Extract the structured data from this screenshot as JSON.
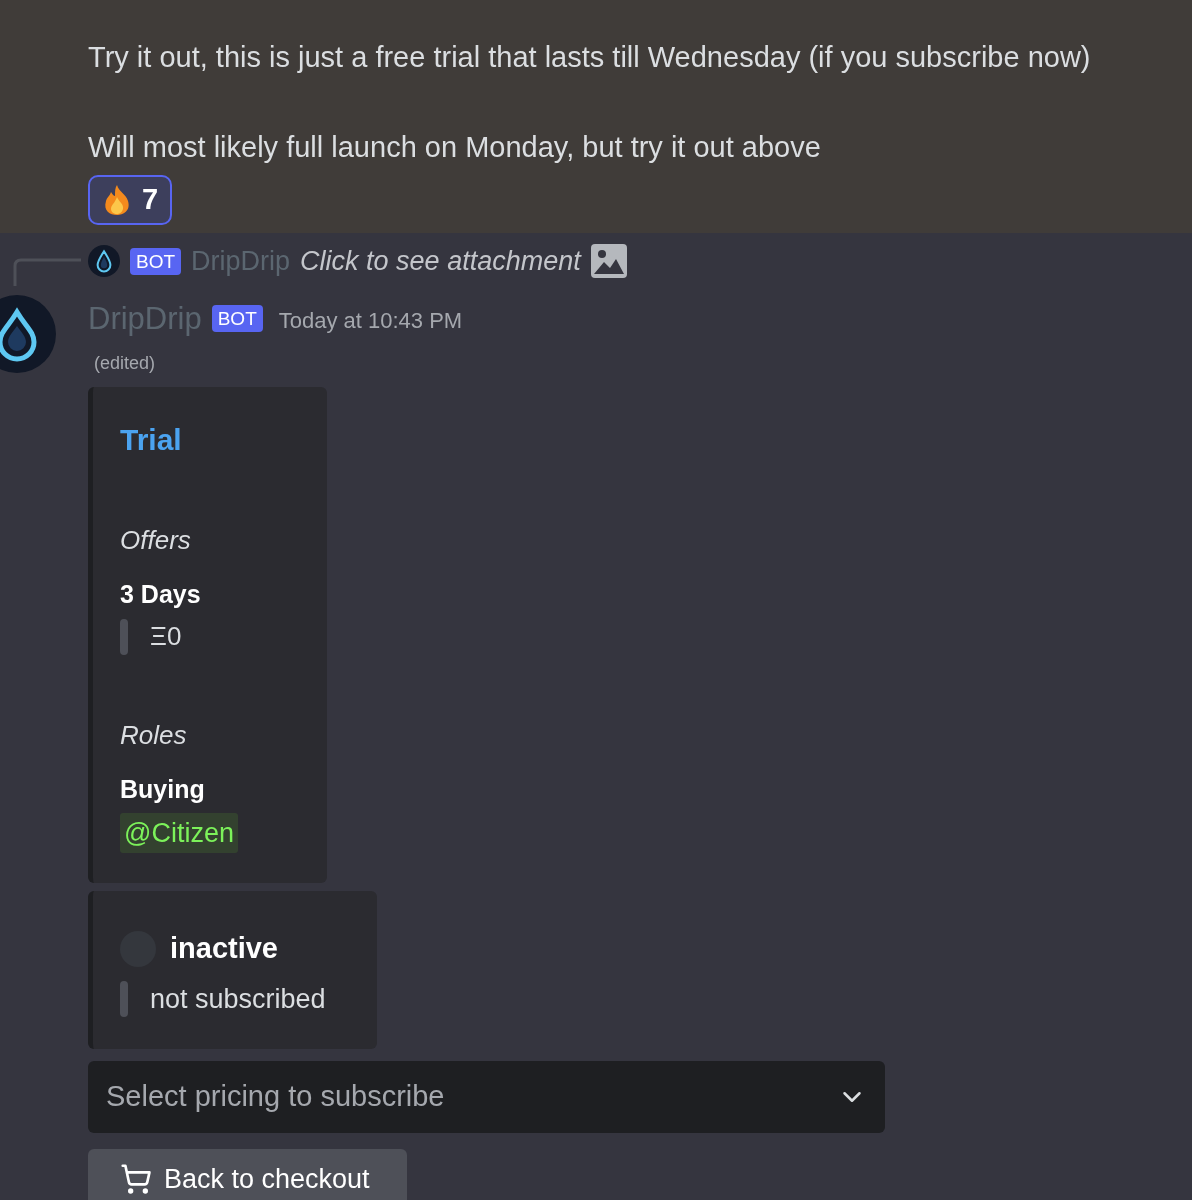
{
  "previous_message": {
    "lines": [
      "Try it out, this is just a free trial that lasts till Wednesday (if you subscribe now)",
      "Will most likely full launch on Monday, but try it out above"
    ],
    "reactions": [
      {
        "count": "7",
        "selected": true
      }
    ]
  },
  "reply_preview": {
    "badge": "BOT",
    "author": "DripDrip",
    "text": "Click to see attachment"
  },
  "message": {
    "author": "DripDrip",
    "badge": "BOT",
    "timestamp": "Today at 10:43 PM",
    "edited": "(edited)",
    "embeds": [
      {
        "kind": "offer",
        "title": "Trial",
        "sections": [
          {
            "heading": "Offers",
            "name": "3 Days",
            "value": "Ξ0"
          },
          {
            "heading": "Roles",
            "name": "Buying",
            "role": "@Citizen"
          }
        ]
      },
      {
        "kind": "status",
        "title": "inactive",
        "value": "not subscribed"
      }
    ],
    "select": {
      "placeholder": "Select pricing to subscribe"
    },
    "button": {
      "label": "Back to checkout"
    }
  }
}
